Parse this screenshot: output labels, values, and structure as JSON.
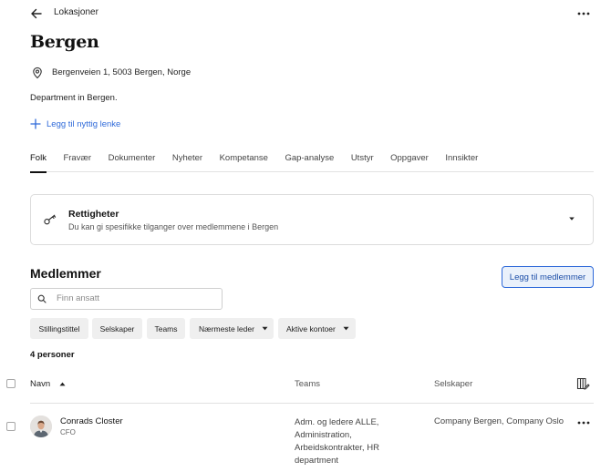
{
  "topbar": {
    "back_icon": "arrow-left-icon",
    "title": "Lokasjoner",
    "more_icon": "more-horizontal-icon"
  },
  "page": {
    "title": "Bergen",
    "address_icon": "map-pin-icon",
    "address": "Bergenveien 1, 5003 Bergen, Norge",
    "description": "Department in Bergen.",
    "add_link_label": "Legg til nyttig lenke"
  },
  "tabs": [
    {
      "label": "Folk",
      "active": true
    },
    {
      "label": "Fravær",
      "active": false
    },
    {
      "label": "Dokumenter",
      "active": false
    },
    {
      "label": "Nyheter",
      "active": false
    },
    {
      "label": "Kompetanse",
      "active": false
    },
    {
      "label": "Gap-analyse",
      "active": false
    },
    {
      "label": "Utstyr",
      "active": false
    },
    {
      "label": "Oppgaver",
      "active": false
    },
    {
      "label": "Innsikter",
      "active": false
    }
  ],
  "permissions": {
    "icon": "key-icon",
    "title": "Rettigheter",
    "subtitle": "Du kan gi spesifikke tilganger over medlemmene i Bergen"
  },
  "members": {
    "title": "Medlemmer",
    "add_button": "Legg til medlemmer",
    "search_placeholder": "Finn ansatt",
    "filters": [
      {
        "label": "Stillingstittel",
        "dropdown": false
      },
      {
        "label": "Selskaper",
        "dropdown": false
      },
      {
        "label": "Teams",
        "dropdown": false
      },
      {
        "label": "Nærmeste leder",
        "dropdown": true
      },
      {
        "label": "Aktive kontoer",
        "dropdown": true
      }
    ],
    "count_label": "4 personer",
    "columns": {
      "name": "Navn",
      "teams": "Teams",
      "companies": "Selskaper"
    },
    "rows": [
      {
        "name": "Conrads Closter",
        "role": "CFO",
        "teams": "Adm. og ledere ALLE, Administration, Arbeidskontrakter, HR department",
        "companies": "Company Bergen, Company Oslo"
      }
    ]
  },
  "colors": {
    "accent": "#2f6ad9",
    "button_bg": "#eaf1fb",
    "chip_bg": "#efefef"
  }
}
